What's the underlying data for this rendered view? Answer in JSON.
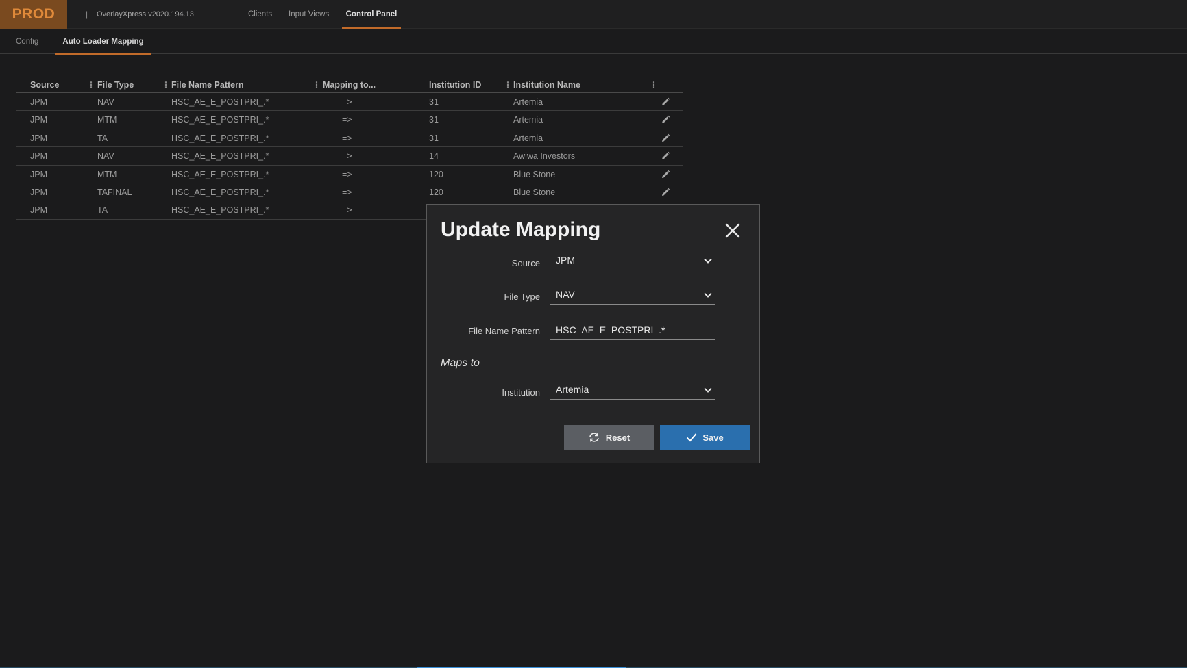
{
  "topbar": {
    "env": "PROD",
    "separator": "|",
    "version": "OverlayXpress v2020.194.13",
    "nav": [
      "Clients",
      "Input Views",
      "Control Panel"
    ],
    "active_nav": "Control Panel"
  },
  "subtabs": {
    "items": [
      "Config",
      "Auto Loader Mapping"
    ],
    "active": "Auto Loader Mapping"
  },
  "grid": {
    "columns": [
      "Source",
      "File Type",
      "File Name Pattern",
      "Mapping to...",
      "Institution ID",
      "Institution Name"
    ],
    "rows": [
      {
        "source": "JPM",
        "file_type": "NAV",
        "pattern": "HSC_AE_E_POSTPRI_.*",
        "mapping": "=>",
        "inst_id": "31",
        "inst_name": "Artemia"
      },
      {
        "source": "JPM",
        "file_type": "MTM",
        "pattern": "HSC_AE_E_POSTPRI_.*",
        "mapping": "=>",
        "inst_id": "31",
        "inst_name": "Artemia"
      },
      {
        "source": "JPM",
        "file_type": "TA",
        "pattern": "HSC_AE_E_POSTPRI_.*",
        "mapping": "=>",
        "inst_id": "31",
        "inst_name": "Artemia"
      },
      {
        "source": "JPM",
        "file_type": "NAV",
        "pattern": "HSC_AE_E_POSTPRI_.*",
        "mapping": "=>",
        "inst_id": "14",
        "inst_name": "Awiwa Investors"
      },
      {
        "source": "JPM",
        "file_type": "MTM",
        "pattern": "HSC_AE_E_POSTPRI_.*",
        "mapping": "=>",
        "inst_id": "120",
        "inst_name": "Blue Stone"
      },
      {
        "source": "JPM",
        "file_type": "TAFINAL",
        "pattern": "HSC_AE_E_POSTPRI_.*",
        "mapping": "=>",
        "inst_id": "120",
        "inst_name": "Blue Stone"
      },
      {
        "source": "JPM",
        "file_type": "TA",
        "pattern": "HSC_AE_E_POSTPRI_.*",
        "mapping": "=>",
        "inst_id": "",
        "inst_name": ""
      }
    ]
  },
  "modal": {
    "title": "Update Mapping",
    "source_label": "Source",
    "source_value": "JPM",
    "file_type_label": "File Type",
    "file_type_value": "NAV",
    "pattern_label": "File Name Pattern",
    "pattern_value": "HSC_AE_E_POSTPRI_.*",
    "maps_to": "Maps to",
    "institution_label": "Institution",
    "institution_value": "Artemia",
    "reset_label": "Reset",
    "save_label": "Save"
  },
  "colors": {
    "accent": "#c26b2a",
    "env_badge_bg": "#7a4a1f",
    "env_badge_text": "#e08a3a",
    "save_button": "#2a6fae",
    "reset_button": "#5b5e63"
  },
  "icons": {
    "edit": "pencil-icon",
    "close": "close-icon",
    "dropdown": "chevron-down-icon",
    "reset": "refresh-icon",
    "save": "check-icon",
    "column_menu": "vertical-dots-icon"
  }
}
